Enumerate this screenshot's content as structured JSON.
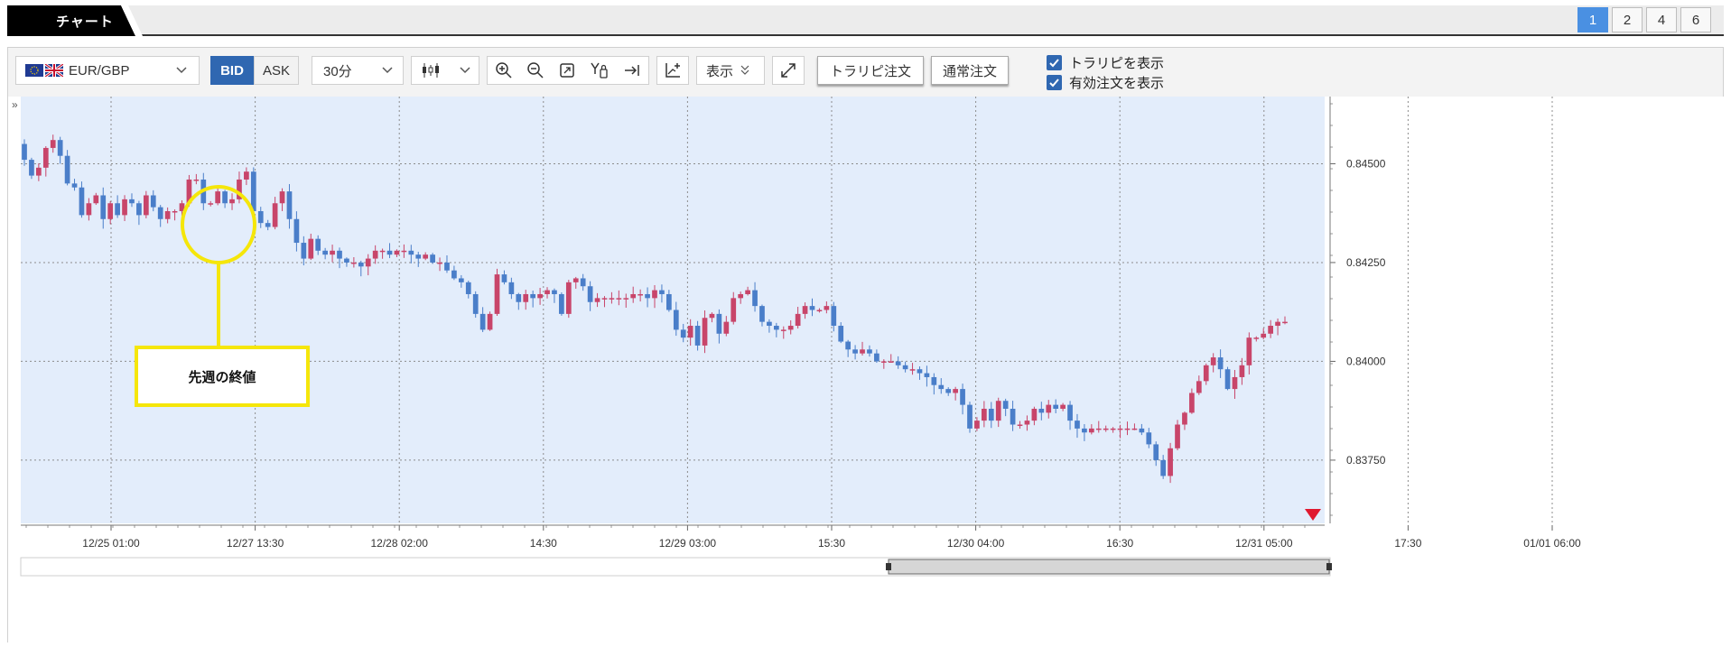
{
  "header": {
    "tab_label": "チャート",
    "layout_options": [
      "1",
      "2",
      "4",
      "6"
    ],
    "active_layout": "1"
  },
  "toolbar": {
    "symbol": "EUR/GBP",
    "bid_label": "BID",
    "ask_label": "ASK",
    "interval": "30分",
    "display_label": "表示",
    "trail_order_label": "トラリピ注文",
    "normal_order_label": "通常注文",
    "show_trail_label": "トラリピを表示",
    "show_active_orders_label": "有効注文を表示",
    "show_trail_checked": true,
    "show_active_orders_checked": true
  },
  "colors": {
    "up": "#c8456a",
    "down": "#4a7ec9",
    "plot_bg": "#e3edfb",
    "accent": "#2f67b1",
    "annotation": "#f5e60a"
  },
  "annotation": {
    "label": "先週の終値"
  },
  "chart_data": {
    "type": "candlestick",
    "x_ticks": [
      "12/25 01:00",
      "12/27 13:30",
      "12/28 02:00",
      "14:30",
      "12/29 03:00",
      "15:30",
      "12/30 04:00",
      "16:30",
      "12/31 05:00",
      "17:30",
      "01/01 06:00"
    ],
    "y_ticks": [
      "0.84500",
      "0.84250",
      "0.84000",
      "0.83750"
    ],
    "ylim": [
      0.8359,
      0.8467
    ],
    "closes": [
      0.8451,
      0.8447,
      0.8449,
      0.8454,
      0.8456,
      0.8452,
      0.8445,
      0.8444,
      0.8437,
      0.844,
      0.8442,
      0.8436,
      0.844,
      0.8437,
      0.8441,
      0.844,
      0.8437,
      0.8442,
      0.8439,
      0.8436,
      0.8438,
      0.8438,
      0.844,
      0.8446,
      0.8446,
      0.844,
      0.844,
      0.8443,
      0.844,
      0.8441,
      0.8446,
      0.8448,
      0.8438,
      0.8435,
      0.8434,
      0.844,
      0.8443,
      0.8436,
      0.843,
      0.8426,
      0.8431,
      0.8428,
      0.8427,
      0.8428,
      0.8426,
      0.8425,
      0.8425,
      0.8424,
      0.8426,
      0.8428,
      0.8428,
      0.8427,
      0.8428,
      0.8428,
      0.8427,
      0.8426,
      0.8427,
      0.8425,
      0.8425,
      0.8423,
      0.8421,
      0.842,
      0.8417,
      0.8412,
      0.8408,
      0.8412,
      0.8422,
      0.842,
      0.8417,
      0.8415,
      0.8417,
      0.8416,
      0.8417,
      0.8418,
      0.8417,
      0.8412,
      0.842,
      0.8421,
      0.8419,
      0.8415,
      0.8416,
      0.8416,
      0.8416,
      0.8416,
      0.8416,
      0.8417,
      0.8417,
      0.8416,
      0.8418,
      0.8417,
      0.8413,
      0.8408,
      0.8406,
      0.8409,
      0.8404,
      0.8411,
      0.8412,
      0.8407,
      0.841,
      0.8416,
      0.8417,
      0.8418,
      0.8414,
      0.841,
      0.8409,
      0.8408,
      0.8408,
      0.8409,
      0.8412,
      0.8414,
      0.8413,
      0.8413,
      0.8414,
      0.8409,
      0.8405,
      0.8403,
      0.8402,
      0.8403,
      0.8402,
      0.84,
      0.84,
      0.84,
      0.8399,
      0.8398,
      0.8398,
      0.8397,
      0.8396,
      0.8394,
      0.8393,
      0.8392,
      0.8393,
      0.8389,
      0.8383,
      0.8385,
      0.8388,
      0.8385,
      0.839,
      0.8388,
      0.8384,
      0.8384,
      0.8385,
      0.8388,
      0.8387,
      0.8389,
      0.8388,
      0.8389,
      0.8385,
      0.8383,
      0.8382,
      0.8383,
      0.8383,
      0.8383,
      0.8383,
      0.8383,
      0.8383,
      0.8383,
      0.8382,
      0.8379,
      0.8375,
      0.8371,
      0.8378,
      0.8384,
      0.8387,
      0.8392,
      0.8395,
      0.8399,
      0.8401,
      0.8398,
      0.8393,
      0.8396,
      0.8399,
      0.8406,
      0.8406,
      0.8407,
      0.8409,
      0.841,
      0.841
    ]
  }
}
